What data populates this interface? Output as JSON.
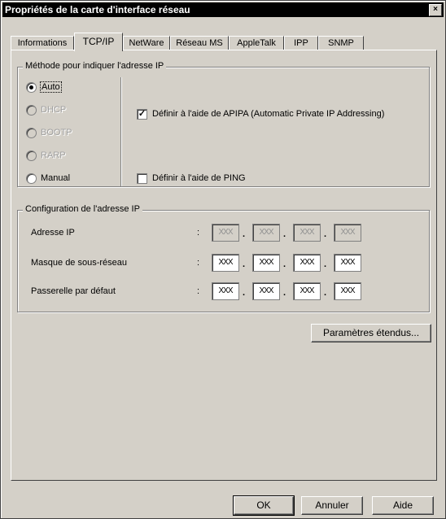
{
  "window": {
    "title": "Propriétés de la carte d'interface réseau",
    "close_label": "×"
  },
  "tabs": [
    "Informations",
    "TCP/IP",
    "NetWare",
    "Réseau MS",
    "AppleTalk",
    "IPP",
    "SNMP"
  ],
  "active_tab": "TCP/IP",
  "ip_method": {
    "legend": "Méthode pour indiquer l'adresse IP",
    "options": [
      {
        "label": "Auto",
        "selected": true,
        "enabled": true
      },
      {
        "label": "DHCP",
        "selected": false,
        "enabled": false
      },
      {
        "label": "BOOTP",
        "selected": false,
        "enabled": false
      },
      {
        "label": "RARP",
        "selected": false,
        "enabled": false
      },
      {
        "label": "Manual",
        "selected": false,
        "enabled": true
      }
    ],
    "apipa_checkbox": {
      "label": "Définir à l'aide de APIPA (Automatic Private IP Addressing)",
      "checked": true
    },
    "ping_checkbox": {
      "label": "Définir à l'aide de PING",
      "checked": false
    }
  },
  "ip_config": {
    "legend": "Configuration de l'adresse IP",
    "rows": [
      {
        "label": "Adresse IP",
        "octets": [
          "XXX",
          "XXX",
          "XXX",
          "XXX"
        ],
        "enabled": false
      },
      {
        "label": "Masque de sous-réseau",
        "octets": [
          "XXX",
          "XXX",
          "XXX",
          "XXX"
        ],
        "enabled": true
      },
      {
        "label": "Passerelle par défaut",
        "octets": [
          "XXX",
          "XXX",
          "XXX",
          "XXX"
        ],
        "enabled": true
      }
    ],
    "separator": ":",
    "octet_dot": "."
  },
  "buttons": {
    "advanced": "Paramètres étendus...",
    "ok": "OK",
    "cancel": "Annuler",
    "help": "Aide"
  }
}
